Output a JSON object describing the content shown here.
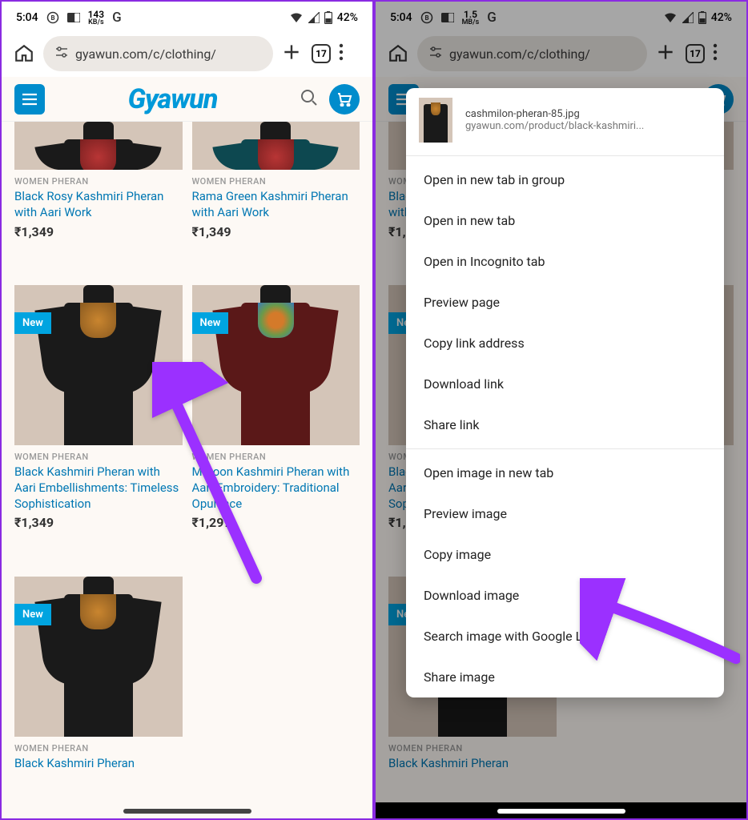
{
  "status": {
    "time": "5:04",
    "net_left": "143",
    "net_left_unit": "KB/s",
    "net_right": "1.5",
    "net_right_unit": "MB/s",
    "battery": "42%"
  },
  "browser": {
    "url": "gyawun.com/c/clothing/",
    "tab_count": "17"
  },
  "site": {
    "logo": "Gyawun"
  },
  "products": [
    {
      "category": "WOMEN PHERAN",
      "title": "Black Rosy Kashmiri Pheran with Aari Work",
      "price": "₹1,349",
      "new": false,
      "color": "black",
      "neck": "red",
      "partial": "top"
    },
    {
      "category": "WOMEN PHERAN",
      "title": "Rama Green Kashmiri Pheran with Aari Work",
      "price": "₹1,349",
      "new": false,
      "color": "teal",
      "neck": "red",
      "partial": "top"
    },
    {
      "category": "WOMEN PHERAN",
      "title": "Black Kashmiri Pheran with Aari Embellishments: Timeless Sophistication",
      "price": "₹1,349",
      "new": true,
      "color": "black",
      "neck": "gold"
    },
    {
      "category": "WOMEN PHERAN",
      "title": "Maroon Kashmiri Pheran with Aari Embroidery: Traditional Opulence",
      "price": "₹1,299",
      "new": true,
      "color": "maroon",
      "neck": "multi"
    },
    {
      "category": "WOMEN PHERAN",
      "title": "Black Kashmiri Pheran",
      "price": "",
      "new": true,
      "color": "black",
      "neck": "gold",
      "partial": "bottom"
    }
  ],
  "context_menu": {
    "filename": "cashmilon-pheran-85.jpg",
    "source": "gyawun.com/product/black-kashmiri...",
    "items_a": [
      "Open in new tab in group",
      "Open in new tab",
      "Open in Incognito tab",
      "Preview page",
      "Copy link address",
      "Download link",
      "Share link"
    ],
    "items_b": [
      "Open image in new tab",
      "Preview image",
      "Copy image",
      "Download image",
      "Search image with Google Lens",
      "Share image"
    ]
  }
}
